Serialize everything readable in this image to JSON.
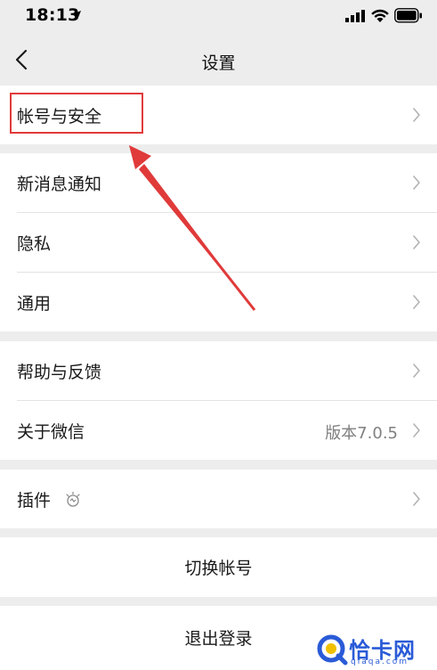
{
  "status_bar": {
    "time": "18:13"
  },
  "nav": {
    "title": "设置"
  },
  "groups": [
    {
      "items": [
        {
          "label": "帐号与安全"
        }
      ]
    },
    {
      "items": [
        {
          "label": "新消息通知"
        },
        {
          "label": "隐私"
        },
        {
          "label": "通用"
        }
      ]
    },
    {
      "items": [
        {
          "label": "帮助与反馈"
        },
        {
          "label": "关于微信",
          "value": "版本7.0.5"
        }
      ]
    },
    {
      "items": [
        {
          "label": "插件"
        }
      ]
    }
  ],
  "actions": {
    "switch_account": "切换帐号",
    "logout": "退出登录"
  },
  "annotation": {
    "color": "#e03a3a"
  },
  "watermark": {
    "text": "恰卡网",
    "url": "qiaqa.com"
  }
}
